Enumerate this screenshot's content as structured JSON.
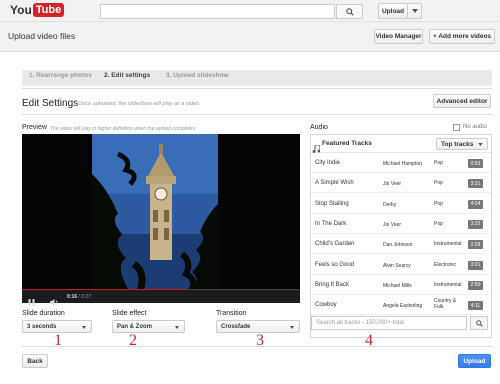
{
  "app": {
    "logo_you": "You",
    "logo_tube": "Tube"
  },
  "topbar": {
    "search_value": "",
    "upload_label": "Upload"
  },
  "header": {
    "title": "Upload video files",
    "video_manager_label": "Video Manager",
    "add_more_label": "+ Add more videos"
  },
  "steps": [
    {
      "label": "1. Rearrange photos",
      "active": false
    },
    {
      "label": "2. Edit settings",
      "active": true
    },
    {
      "label": "3. Upload slideshow",
      "active": false
    }
  ],
  "edit": {
    "title": "Edit Settings",
    "hint": "Once uploaded, the slideshow will play as a video",
    "advanced_label": "Advanced editor"
  },
  "preview": {
    "label": "Preview",
    "hint": "The video will play in higher definition when the upload completes",
    "time_current": "0:16",
    "time_total": "/ 0:27",
    "progress": 0.59
  },
  "settings": {
    "duration_label": "Slide duration",
    "duration_value": "3 seconds",
    "effect_label": "Slide effect",
    "effect_value": "Pan & Zoom",
    "transition_label": "Transition",
    "transition_value": "Crossfade"
  },
  "annotations": [
    "1",
    "2",
    "3",
    "4"
  ],
  "audio": {
    "label": "Audio",
    "no_audio_label": "No audio",
    "featured_label": "Featured Tracks",
    "top_tracks_label": "Top tracks",
    "search_placeholder": "Search all tracks - 150,000+ total",
    "tracks": [
      {
        "title": "City Indie",
        "artist": "Michael Hampton",
        "genre": "Pop",
        "duration": "0:53"
      },
      {
        "title": "A Simple Wish",
        "artist": "Joi Veer",
        "genre": "Pop",
        "duration": "3:31"
      },
      {
        "title": "Stop Stalling",
        "artist": "Derby",
        "genre": "Pop",
        "duration": "4:04"
      },
      {
        "title": "In The Dark",
        "artist": "Joi Veer",
        "genre": "Pop",
        "duration": "3:32"
      },
      {
        "title": "Child's Garden",
        "artist": "Dan Johnson",
        "genre": "Instrumental",
        "duration": "2:28"
      },
      {
        "title": "Feels so Good",
        "artist": "Alvin Searcy",
        "genre": "Electronic",
        "duration": "3:01"
      },
      {
        "title": "Bring It Back",
        "artist": "Michael Mills",
        "genre": "Instrumental",
        "duration": "2:50"
      },
      {
        "title": "Cowboy",
        "artist": "Angela Easterling",
        "genre": "Country & Folk",
        "duration": "4:11"
      }
    ]
  },
  "footer": {
    "back_label": "Back",
    "upload_label": "Upload"
  },
  "colors": {
    "brand_red": "#d3222a",
    "primary_blue": "#4d90fe",
    "annotation_red": "#c0282d"
  }
}
